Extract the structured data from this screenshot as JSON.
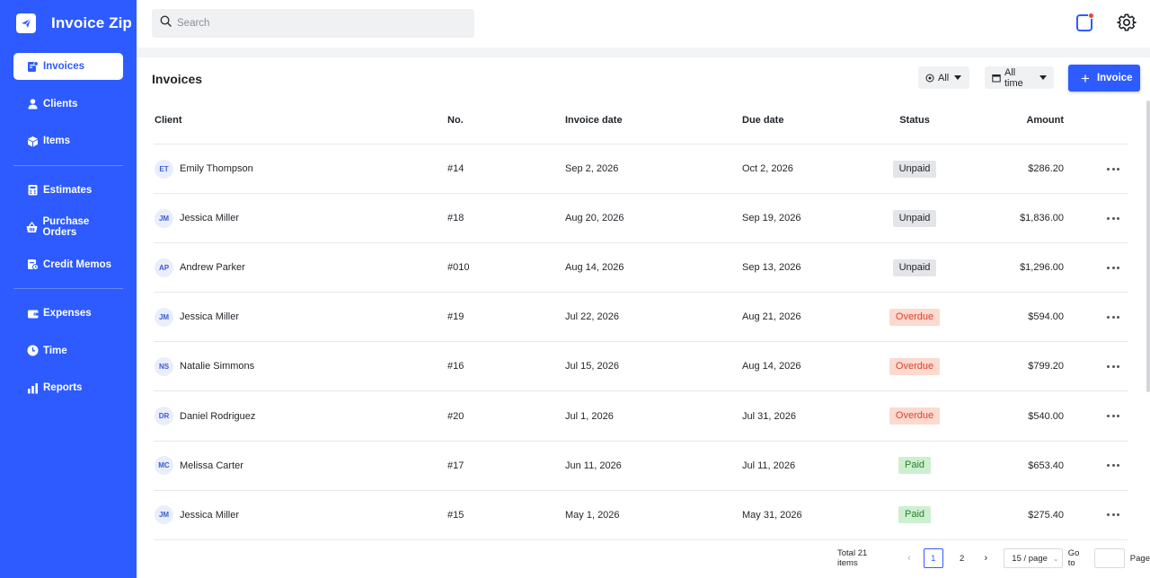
{
  "app": {
    "name": "Invoice Zip"
  },
  "colors": {
    "brand": "#2d5bff",
    "unpaid_bg": "#e3e5e8",
    "overdue_bg": "#fdd9d0",
    "overdue_text": "#d9442b",
    "paid_bg": "#ccf0cf",
    "paid_text": "#2e7d32",
    "notification_dot": "#e8472f"
  },
  "sidebar": {
    "items": [
      {
        "label": "Invoices",
        "icon": "invoice-icon",
        "active": true
      },
      {
        "label": "Clients",
        "icon": "person-icon"
      },
      {
        "label": "Items",
        "icon": "box-icon"
      },
      {
        "label": "Estimates",
        "icon": "calculator-icon"
      },
      {
        "label": "Purchase Orders",
        "icon": "basket-icon"
      },
      {
        "label": "Credit Memos",
        "icon": "memo-icon"
      },
      {
        "label": "Expenses",
        "icon": "wallet-icon"
      },
      {
        "label": "Time",
        "icon": "clock-icon"
      },
      {
        "label": "Reports",
        "icon": "bar-chart-icon"
      }
    ]
  },
  "header": {
    "search_placeholder": "Search"
  },
  "main": {
    "title": "Invoices",
    "filter_status": "All",
    "filter_time": "All time",
    "new_button": "Invoice",
    "columns": {
      "client": "Client",
      "no": "No.",
      "invoice_date": "Invoice date",
      "due_date": "Due date",
      "status": "Status",
      "amount": "Amount"
    },
    "rows": [
      {
        "initials": "ET",
        "client": "Emily Thompson",
        "no": "#14",
        "invoice_date": "Sep 2, 2026",
        "due_date": "Oct 2, 2026",
        "status": "Unpaid",
        "amount": "$286.20"
      },
      {
        "initials": "JM",
        "client": "Jessica Miller",
        "no": "#18",
        "invoice_date": "Aug 20, 2026",
        "due_date": "Sep 19, 2026",
        "status": "Unpaid",
        "amount": "$1,836.00"
      },
      {
        "initials": "AP",
        "client": "Andrew Parker",
        "no": "#010",
        "invoice_date": "Aug 14, 2026",
        "due_date": "Sep 13, 2026",
        "status": "Unpaid",
        "amount": "$1,296.00"
      },
      {
        "initials": "JM",
        "client": "Jessica Miller",
        "no": "#19",
        "invoice_date": "Jul 22, 2026",
        "due_date": "Aug 21, 2026",
        "status": "Overdue",
        "amount": "$594.00"
      },
      {
        "initials": "NS",
        "client": "Natalie Simmons",
        "no": "#16",
        "invoice_date": "Jul 15, 2026",
        "due_date": "Aug 14, 2026",
        "status": "Overdue",
        "amount": "$799.20"
      },
      {
        "initials": "DR",
        "client": "Daniel Rodriguez",
        "no": "#20",
        "invoice_date": "Jul 1, 2026",
        "due_date": "Jul 31, 2026",
        "status": "Overdue",
        "amount": "$540.00"
      },
      {
        "initials": "MC",
        "client": "Melissa Carter",
        "no": "#17",
        "invoice_date": "Jun 11, 2026",
        "due_date": "Jul 11, 2026",
        "status": "Paid",
        "amount": "$653.40"
      },
      {
        "initials": "JM",
        "client": "Jessica Miller",
        "no": "#15",
        "invoice_date": "May 1, 2026",
        "due_date": "May 31, 2026",
        "status": "Paid",
        "amount": "$275.40"
      }
    ]
  },
  "pagination": {
    "total": "Total 21 items",
    "pages": [
      "1",
      "2"
    ],
    "current_page": "1",
    "page_size": "15 / page",
    "goto_label": "Go to",
    "page_label": "Page"
  }
}
